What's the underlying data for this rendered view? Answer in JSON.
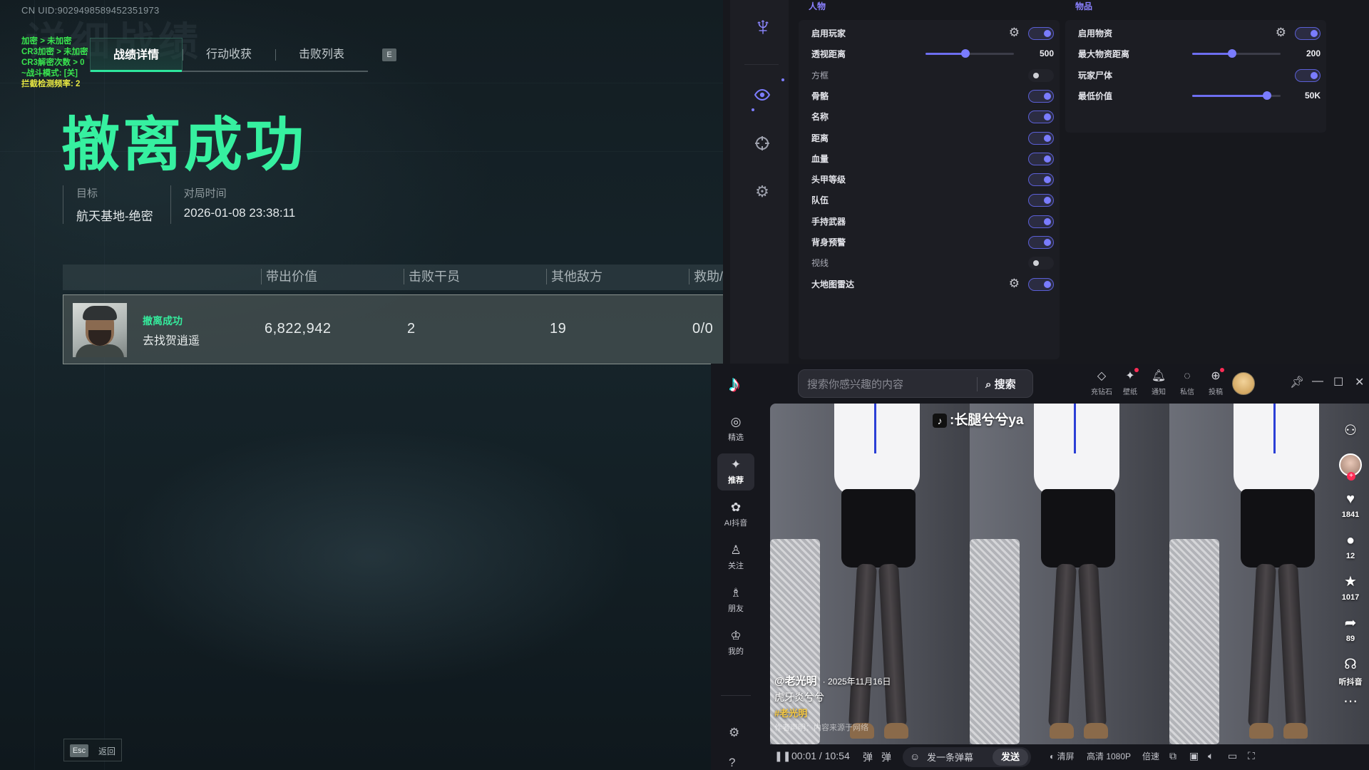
{
  "game": {
    "uid": "CN UID:9029498589452351973",
    "ghost_title": "详细战绩",
    "debug": [
      "加密 > 未加密",
      "CR3加密 > 未加密",
      "CR3解密次数 > 0",
      "~战斗模式: [关]",
      "拦截检测频率: 2"
    ],
    "tabs": [
      "战绩详情",
      "行动收获",
      "击败列表"
    ],
    "tab_key": "E",
    "title": "撤离成功",
    "meta": [
      {
        "label": "目标",
        "value": "航天基地-绝密"
      },
      {
        "label": "对局时间",
        "value": "2026-01-08 23:38:11"
      }
    ],
    "stats_headers": [
      "带出价值",
      "击败干员",
      "其他敌方",
      "救助/"
    ],
    "row": {
      "status": "撤离成功",
      "name": "去找贺逍遥",
      "value": "6,822,942",
      "kills": "2",
      "others": "19",
      "rescue": "0/0"
    },
    "esc": {
      "key": "Esc",
      "label": "返回"
    }
  },
  "menu": {
    "section_people": "人物",
    "section_items": "物品",
    "people": [
      {
        "label": "启用玩家",
        "type": "toggle",
        "on": true,
        "gear": true
      },
      {
        "label": "透视距离",
        "type": "slider",
        "value": "500",
        "fraction": 0.45
      },
      {
        "label": "方框",
        "type": "toggle",
        "on": false,
        "dim": true
      },
      {
        "label": "骨骼",
        "type": "toggle",
        "on": true
      },
      {
        "label": "名称",
        "type": "toggle",
        "on": true
      },
      {
        "label": "距离",
        "type": "toggle",
        "on": true
      },
      {
        "label": "血量",
        "type": "toggle",
        "on": true
      },
      {
        "label": "头甲等级",
        "type": "toggle",
        "on": true
      },
      {
        "label": "队伍",
        "type": "toggle",
        "on": true
      },
      {
        "label": "手持武器",
        "type": "toggle",
        "on": true
      },
      {
        "label": "背身预警",
        "type": "toggle",
        "on": true
      },
      {
        "label": "视线",
        "type": "toggle",
        "on": false,
        "dim": true
      },
      {
        "label": "大地图雷达",
        "type": "toggle",
        "on": true,
        "gear": true
      }
    ],
    "items": [
      {
        "label": "启用物资",
        "type": "toggle",
        "on": true,
        "gear": true
      },
      {
        "label": "最大物资距离",
        "type": "slider",
        "value": "200",
        "fraction": 0.45
      },
      {
        "label": "玩家尸体",
        "type": "toggle",
        "on": true
      },
      {
        "label": "最低价值",
        "type": "slider",
        "value": "50K",
        "fraction": 0.85
      }
    ]
  },
  "douyin": {
    "search_placeholder": "搜索你感兴趣的内容",
    "search_button": "搜索",
    "top_tools": [
      "充钻石",
      "壁纸",
      "通知",
      "私信",
      "投稿"
    ],
    "nav": [
      "精选",
      "推荐",
      "AI抖音",
      "关注",
      "朋友",
      "我的"
    ],
    "watermark": "长腿兮兮ya",
    "author": "@老光明",
    "date": "· 2025年11月16日",
    "caption": "虎牙炎兮兮",
    "tag": "#老光明",
    "disclaimer": "作者声明：内容来源于网络",
    "actions": [
      {
        "icon": "heart-icon",
        "count": "1841"
      },
      {
        "icon": "comment-icon",
        "count": "12"
      },
      {
        "icon": "star-icon",
        "count": "1017"
      },
      {
        "icon": "share-icon",
        "count": "89"
      },
      {
        "icon": "headphones-icon",
        "count": "听抖音"
      }
    ],
    "time": "00:01 / 10:54",
    "danmu_placeholder": "发一条弹幕",
    "danmu_send": "发送",
    "bottom_right": [
      "清屏",
      "高清 1080P",
      "倍速"
    ]
  }
}
